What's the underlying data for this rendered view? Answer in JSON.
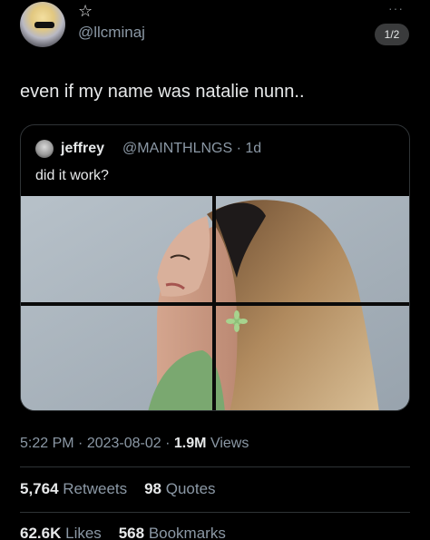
{
  "header": {
    "star_icon": "☆",
    "handle": "@llcminaj",
    "more_icon": "···",
    "page_badge": "1/2"
  },
  "tweet": {
    "text": "even if my name was natalie nunn.."
  },
  "quoted_tweet": {
    "name": "jeffrey",
    "handle_time": "@MAINTHLNGS · 1d",
    "text": "did it work?"
  },
  "meta": {
    "time": "5:22 PM",
    "date": "2023-08-02",
    "views_count": "1.9M",
    "views_label": "Views",
    "sep": "·"
  },
  "stats": {
    "retweets_count": "5,764",
    "retweets_label": "Retweets",
    "quotes_count": "98",
    "quotes_label": "Quotes",
    "likes_count": "62.6K",
    "likes_label": "Likes",
    "bookmarks_count": "568",
    "bookmarks_label": "Bookmarks"
  },
  "colors": {
    "background": "#000000",
    "text_primary": "#e7e9ea",
    "text_secondary": "#8b98a5",
    "border": "#2f3336"
  }
}
